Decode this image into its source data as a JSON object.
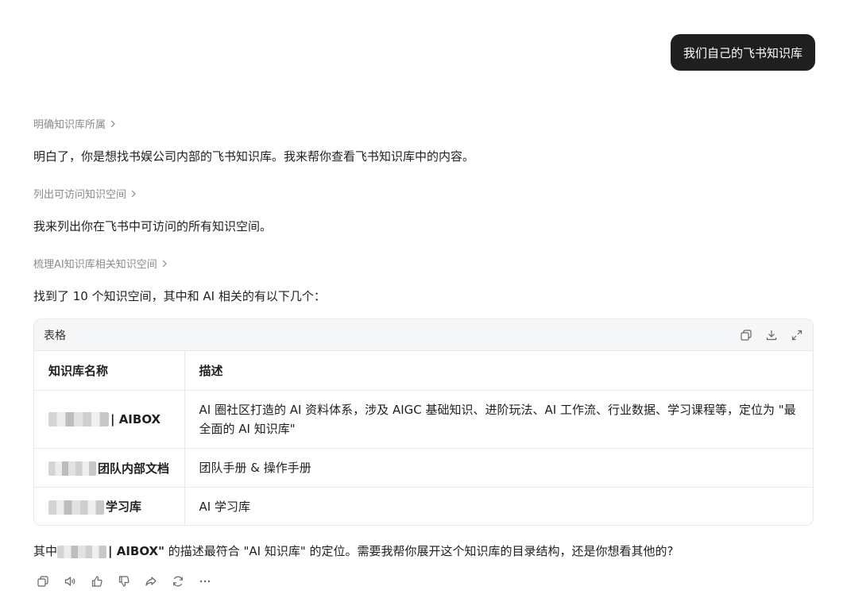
{
  "user_message": "我们自己的飞书知识库",
  "steps": [
    {
      "label": "明确知识库所属"
    },
    {
      "label": "列出可访问知识空间"
    },
    {
      "label": "梳理AI知识库相关知识空间"
    }
  ],
  "responses": [
    "明白了，你是想找书娱公司内部的飞书知识库。我来帮你查看飞书知识库中的内容。",
    "我来列出你在飞书中可访问的所有知识空间。",
    "找到了 10 个知识空间，其中和 AI 相关的有以下几个："
  ],
  "table": {
    "title": "表格",
    "headers": [
      "知识库名称",
      "描述"
    ],
    "rows": [
      {
        "name_suffix": "| AIBOX",
        "desc": "AI 圈社区打造的 AI 资料体系，涉及 AIGC 基础知识、进阶玩法、AI 工作流、行业数据、学习课程等，定位为 \"最全面的 AI 知识库\""
      },
      {
        "name_suffix": "团队内部文档",
        "desc": "团队手册 & 操作手册"
      },
      {
        "name_suffix": "学习库",
        "desc": "AI 学习库"
      }
    ],
    "tools": [
      "copy-icon",
      "download-icon",
      "expand-icon"
    ]
  },
  "final": {
    "prefix": "其中",
    "bold": "| AIBOX\"",
    "suffix": " 的描述最符合 \"AI 知识库\" 的定位。需要我帮你展开这个知识库的目录结构，还是你想看其他的?"
  },
  "actions": [
    "copy-icon",
    "speaker-icon",
    "thumbs-up-icon",
    "thumbs-down-icon",
    "share-icon",
    "regenerate-icon",
    "more-icon"
  ]
}
